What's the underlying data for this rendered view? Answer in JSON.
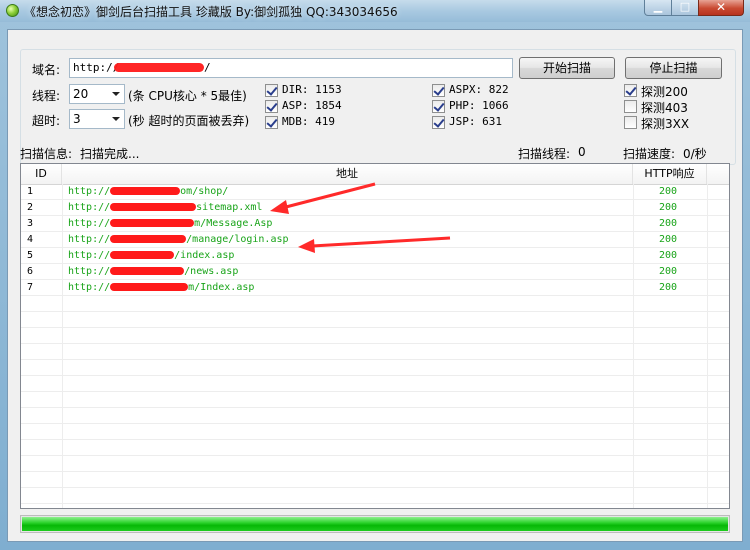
{
  "window": {
    "title": "《想念初恋》御剑后台扫描工具 珍藏版 By:御剑孤独 QQ:343034656",
    "minimize_glyph": "▁",
    "maximize_glyph": "□",
    "close_glyph": "✕"
  },
  "form": {
    "domain_label": "域名:",
    "domain_value": "http://",
    "domain_value_tail": "/",
    "threads_label": "线程:",
    "threads_value": "20",
    "threads_hint": "(条 CPU核心 * 5最佳)",
    "timeout_label": "超时:",
    "timeout_value": "3",
    "timeout_hint": "(秒 超时的页面被丢弃)",
    "start_button": "开始扫描",
    "stop_button": "停止扫描"
  },
  "dictionaries": [
    {
      "label": "DIR: 1153",
      "checked": true
    },
    {
      "label": "ASP: 1854",
      "checked": true
    },
    {
      "label": "MDB: 419",
      "checked": true
    },
    {
      "label": "ASPX: 822",
      "checked": true
    },
    {
      "label": "PHP: 1066",
      "checked": true
    },
    {
      "label": "JSP: 631",
      "checked": true
    }
  ],
  "detect_options": [
    {
      "label": "探测200",
      "checked": true
    },
    {
      "label": "探测403",
      "checked": false
    },
    {
      "label": "探测3XX",
      "checked": false
    }
  ],
  "status": {
    "info_label": "扫描信息:",
    "info_value": "扫描完成...",
    "threads_label": "扫描线程:",
    "threads_value": "0",
    "speed_label": "扫描速度:",
    "speed_value": "0/秒"
  },
  "table": {
    "columns": [
      "ID",
      "地址",
      "HTTP响应"
    ],
    "rows": [
      {
        "id": "1",
        "url_start": "http://",
        "url_end": "om/shop/",
        "code": "200"
      },
      {
        "id": "2",
        "url_start": "http://",
        "url_end": "sitemap.xml",
        "code": "200"
      },
      {
        "id": "3",
        "url_start": "http://",
        "url_end": "m/Message.Asp",
        "code": "200"
      },
      {
        "id": "4",
        "url_start": "http://",
        "url_end": "/manage/login.asp",
        "code": "200"
      },
      {
        "id": "5",
        "url_start": "http://",
        "url_end": "/index.asp",
        "code": "200"
      },
      {
        "id": "6",
        "url_start": "http://",
        "url_end": "/news.asp",
        "code": "200"
      },
      {
        "id": "7",
        "url_start": "http://",
        "url_end": "m/Index.asp",
        "code": "200"
      }
    ]
  },
  "progress": {
    "fraction": 1.0
  },
  "colors": {
    "url_green": "#19a419",
    "redaction_red": "#ff1a1a",
    "progress_green": "#06b806"
  }
}
